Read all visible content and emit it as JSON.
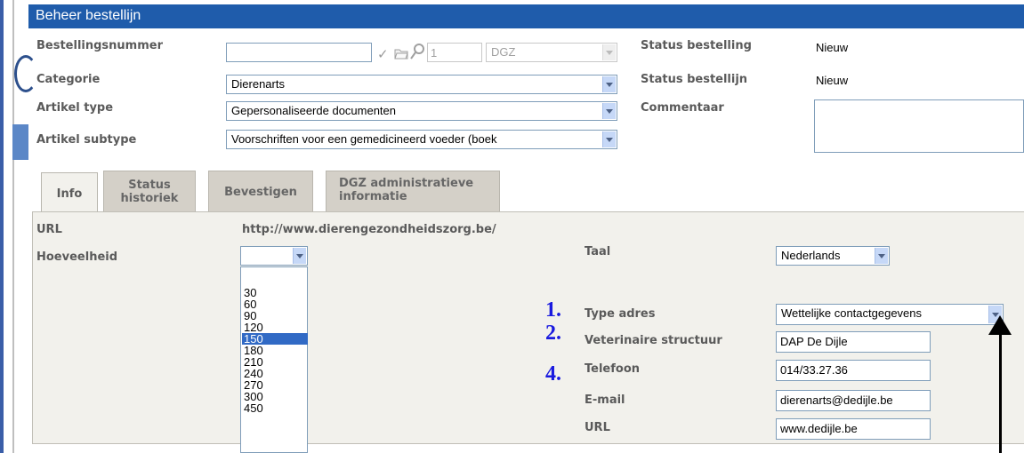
{
  "header": {
    "title": "Beheer bestellijn"
  },
  "order": {
    "number_label": "Bestellingsnummer",
    "number_value": "",
    "check_glyph": "✓",
    "count_value": "1",
    "org_value": "DGZ",
    "category_label": "Categorie",
    "category_value": "Dierenarts",
    "article_type_label": "Artikel type",
    "article_type_value": "Gepersonaliseerde documenten",
    "article_subtype_label": "Artikel subtype",
    "article_subtype_value": "Voorschriften voor een gemedicineerd voeder (boek",
    "status_order_label": "Status bestelling",
    "status_order_value": "Nieuw",
    "status_line_label": "Status bestellijn",
    "status_line_value": "Nieuw",
    "comment_label": "Commentaar",
    "comment_value": ""
  },
  "tabs": [
    {
      "label": "Info",
      "active": true
    },
    {
      "label": "Status historiek",
      "active": false
    },
    {
      "label": "Bevestigen",
      "active": false
    },
    {
      "label": "DGZ administratieve informatie",
      "active": false
    }
  ],
  "info": {
    "url_label": "URL",
    "url_value": "http://www.dierengezondheidszorg.be/",
    "quantity_label": "Hoeveelheid",
    "quantity_value": "",
    "quantity_options": [
      "30",
      "60",
      "90",
      "120",
      "150",
      "180",
      "210",
      "240",
      "270",
      "300",
      "450"
    ],
    "quantity_selected": "150",
    "language_label": "Taal",
    "language_value": "Nederlands",
    "address_type_label": "Type adres",
    "address_type_value": "Wettelijke contactgegevens",
    "vet_structure_label": "Veterinaire structuur",
    "vet_structure_value": "DAP De Dijle",
    "phone_label": "Telefoon",
    "phone_value": "014/33.27.36",
    "email_label": "E-mail",
    "email_value": "dierenarts@dedijle.be",
    "site_label": "URL",
    "site_value": "www.dedijle.be"
  },
  "annotations": {
    "n1": "1.",
    "n2": "2.",
    "n4": "4."
  },
  "colors": {
    "header_bg": "#1f5cab",
    "panel_bg": "#f2f1ec",
    "annotation": "#1a1adf",
    "selection": "#316ac5"
  },
  "icons": [
    "check-icon",
    "folder-icon",
    "magnifier-icon",
    "dropdown-arrow-icon",
    "annotation-arrow-icon"
  ]
}
